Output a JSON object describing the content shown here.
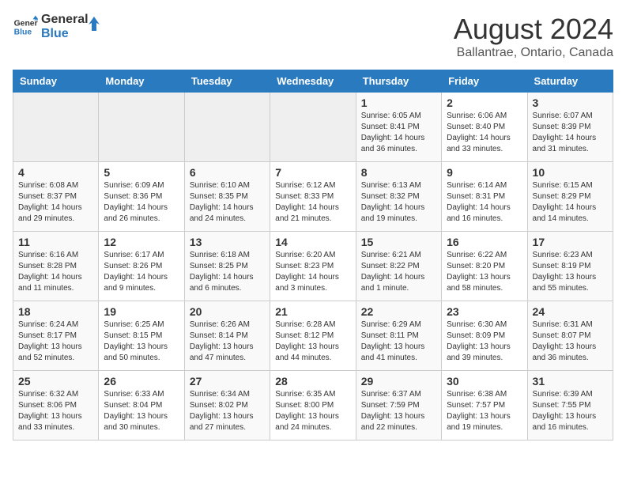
{
  "header": {
    "logo_line1": "General",
    "logo_line2": "Blue",
    "month_year": "August 2024",
    "location": "Ballantrae, Ontario, Canada"
  },
  "days_of_week": [
    "Sunday",
    "Monday",
    "Tuesday",
    "Wednesday",
    "Thursday",
    "Friday",
    "Saturday"
  ],
  "weeks": [
    [
      {
        "day": "",
        "info": ""
      },
      {
        "day": "",
        "info": ""
      },
      {
        "day": "",
        "info": ""
      },
      {
        "day": "",
        "info": ""
      },
      {
        "day": "1",
        "info": "Sunrise: 6:05 AM\nSunset: 8:41 PM\nDaylight: 14 hours\nand 36 minutes."
      },
      {
        "day": "2",
        "info": "Sunrise: 6:06 AM\nSunset: 8:40 PM\nDaylight: 14 hours\nand 33 minutes."
      },
      {
        "day": "3",
        "info": "Sunrise: 6:07 AM\nSunset: 8:39 PM\nDaylight: 14 hours\nand 31 minutes."
      }
    ],
    [
      {
        "day": "4",
        "info": "Sunrise: 6:08 AM\nSunset: 8:37 PM\nDaylight: 14 hours\nand 29 minutes."
      },
      {
        "day": "5",
        "info": "Sunrise: 6:09 AM\nSunset: 8:36 PM\nDaylight: 14 hours\nand 26 minutes."
      },
      {
        "day": "6",
        "info": "Sunrise: 6:10 AM\nSunset: 8:35 PM\nDaylight: 14 hours\nand 24 minutes."
      },
      {
        "day": "7",
        "info": "Sunrise: 6:12 AM\nSunset: 8:33 PM\nDaylight: 14 hours\nand 21 minutes."
      },
      {
        "day": "8",
        "info": "Sunrise: 6:13 AM\nSunset: 8:32 PM\nDaylight: 14 hours\nand 19 minutes."
      },
      {
        "day": "9",
        "info": "Sunrise: 6:14 AM\nSunset: 8:31 PM\nDaylight: 14 hours\nand 16 minutes."
      },
      {
        "day": "10",
        "info": "Sunrise: 6:15 AM\nSunset: 8:29 PM\nDaylight: 14 hours\nand 14 minutes."
      }
    ],
    [
      {
        "day": "11",
        "info": "Sunrise: 6:16 AM\nSunset: 8:28 PM\nDaylight: 14 hours\nand 11 minutes."
      },
      {
        "day": "12",
        "info": "Sunrise: 6:17 AM\nSunset: 8:26 PM\nDaylight: 14 hours\nand 9 minutes."
      },
      {
        "day": "13",
        "info": "Sunrise: 6:18 AM\nSunset: 8:25 PM\nDaylight: 14 hours\nand 6 minutes."
      },
      {
        "day": "14",
        "info": "Sunrise: 6:20 AM\nSunset: 8:23 PM\nDaylight: 14 hours\nand 3 minutes."
      },
      {
        "day": "15",
        "info": "Sunrise: 6:21 AM\nSunset: 8:22 PM\nDaylight: 14 hours\nand 1 minute."
      },
      {
        "day": "16",
        "info": "Sunrise: 6:22 AM\nSunset: 8:20 PM\nDaylight: 13 hours\nand 58 minutes."
      },
      {
        "day": "17",
        "info": "Sunrise: 6:23 AM\nSunset: 8:19 PM\nDaylight: 13 hours\nand 55 minutes."
      }
    ],
    [
      {
        "day": "18",
        "info": "Sunrise: 6:24 AM\nSunset: 8:17 PM\nDaylight: 13 hours\nand 52 minutes."
      },
      {
        "day": "19",
        "info": "Sunrise: 6:25 AM\nSunset: 8:15 PM\nDaylight: 13 hours\nand 50 minutes."
      },
      {
        "day": "20",
        "info": "Sunrise: 6:26 AM\nSunset: 8:14 PM\nDaylight: 13 hours\nand 47 minutes."
      },
      {
        "day": "21",
        "info": "Sunrise: 6:28 AM\nSunset: 8:12 PM\nDaylight: 13 hours\nand 44 minutes."
      },
      {
        "day": "22",
        "info": "Sunrise: 6:29 AM\nSunset: 8:11 PM\nDaylight: 13 hours\nand 41 minutes."
      },
      {
        "day": "23",
        "info": "Sunrise: 6:30 AM\nSunset: 8:09 PM\nDaylight: 13 hours\nand 39 minutes."
      },
      {
        "day": "24",
        "info": "Sunrise: 6:31 AM\nSunset: 8:07 PM\nDaylight: 13 hours\nand 36 minutes."
      }
    ],
    [
      {
        "day": "25",
        "info": "Sunrise: 6:32 AM\nSunset: 8:06 PM\nDaylight: 13 hours\nand 33 minutes."
      },
      {
        "day": "26",
        "info": "Sunrise: 6:33 AM\nSunset: 8:04 PM\nDaylight: 13 hours\nand 30 minutes."
      },
      {
        "day": "27",
        "info": "Sunrise: 6:34 AM\nSunset: 8:02 PM\nDaylight: 13 hours\nand 27 minutes."
      },
      {
        "day": "28",
        "info": "Sunrise: 6:35 AM\nSunset: 8:00 PM\nDaylight: 13 hours\nand 24 minutes."
      },
      {
        "day": "29",
        "info": "Sunrise: 6:37 AM\nSunset: 7:59 PM\nDaylight: 13 hours\nand 22 minutes."
      },
      {
        "day": "30",
        "info": "Sunrise: 6:38 AM\nSunset: 7:57 PM\nDaylight: 13 hours\nand 19 minutes."
      },
      {
        "day": "31",
        "info": "Sunrise: 6:39 AM\nSunset: 7:55 PM\nDaylight: 13 hours\nand 16 minutes."
      }
    ]
  ]
}
